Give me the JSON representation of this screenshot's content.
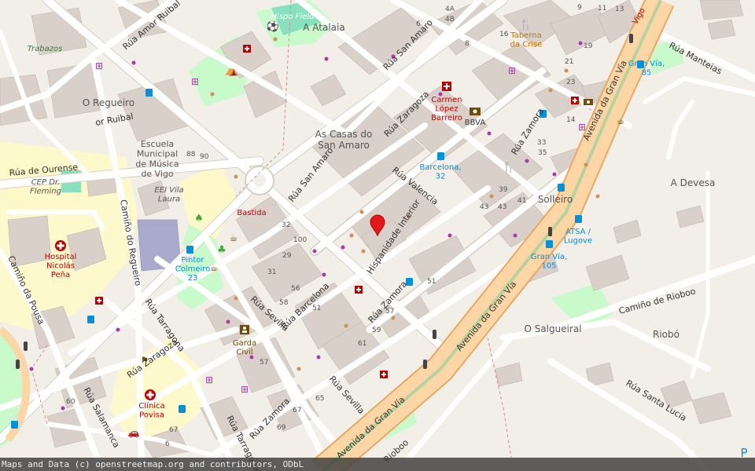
{
  "colors": {
    "background": "#f2efe9",
    "building": "#d9d0c9",
    "road_minor": "#ffffff",
    "road_primary": "#fcd6a4",
    "road_primary_casing": "#e9a863",
    "park": "#c8facc",
    "pitch": "#88e0be",
    "hospital_grounds": "#fdf9cc",
    "school_grounds": "#fff8c8",
    "healthcare_red": "#c00000",
    "shop_purple": "#ac39ac",
    "amenity_brown": "#734a08",
    "transport_blue": "#0092da",
    "marker_red": "#e31a1c"
  },
  "streets": [
    {
      "name": "Rúa de Ourense",
      "kind": "minor"
    },
    {
      "name": "Rúa Amor Ruibal",
      "kind": "minor"
    },
    {
      "name": "Rúa San Amaro",
      "kind": "minor"
    },
    {
      "name": "Rúa Zaragoza",
      "kind": "minor"
    },
    {
      "name": "Rúa Valencia",
      "kind": "minor"
    },
    {
      "name": "Rúa Zamora",
      "kind": "minor"
    },
    {
      "name": "Rúa Barcelona",
      "kind": "minor"
    },
    {
      "name": "Rúa Sevilla",
      "kind": "minor"
    },
    {
      "name": "Rúa Tarragona",
      "kind": "minor"
    },
    {
      "name": "Rúa Salamanca",
      "kind": "minor"
    },
    {
      "name": "Camiño do Regueiro",
      "kind": "minor"
    },
    {
      "name": "Camiño da Pousa",
      "kind": "minor"
    },
    {
      "name": "Avenida da Gran Vía",
      "kind": "primary"
    },
    {
      "name": "Rúa Manteias",
      "kind": "minor"
    },
    {
      "name": "Camiño de Rioboo",
      "kind": "minor"
    },
    {
      "name": "Rúa Santa Lucía",
      "kind": "minor"
    },
    {
      "name": "Hispanidade Interior",
      "kind": "minor"
    },
    {
      "name": "Rioboo",
      "kind": "minor"
    }
  ],
  "places": [
    {
      "name": "O Regueiro"
    },
    {
      "name": "As Casas do\nSan Amaro"
    },
    {
      "name": "A Atalaia"
    },
    {
      "name": "Solleiro"
    },
    {
      "name": "A Devesa"
    },
    {
      "name": "O Salgueiral"
    },
    {
      "name": "Riobó"
    },
    {
      "name": "Trabazos"
    },
    {
      "name": "Escuela\nMunicipal\nde Música\nde Vigo"
    },
    {
      "name": "EEI Vila\nLaura"
    },
    {
      "name": "CEP Dr.\nFleming"
    },
    {
      "name": "Bastida"
    },
    {
      "name": "Vigo"
    }
  ],
  "pois": [
    {
      "name": "Hospital\nNicolás\nPeña",
      "category": "hospital",
      "icon": "hospital-icon"
    },
    {
      "name": "Clínica\nPovisa",
      "category": "hospital",
      "icon": "hospital-icon"
    },
    {
      "name": "Carmen\nLópez\nBarreiro",
      "category": "pharmacy",
      "icon": "pharmacy-icon"
    },
    {
      "name": "Taberna\nda Crise",
      "category": "restaurant",
      "icon": "restaurant-icon"
    },
    {
      "name": "BBVA",
      "category": "bank",
      "icon": "bank-icon"
    },
    {
      "name": "Garda\nCivil",
      "category": "police",
      "icon": "police-icon"
    },
    {
      "name": "Hispo Field",
      "category": "sports",
      "icon": "pitch-icon"
    }
  ],
  "bus_stops": [
    {
      "name": "Barcelona,\n32"
    },
    {
      "name": "Gran Vía,\n85"
    },
    {
      "name": "ATSA /\nLugove"
    },
    {
      "name": "Gran Vía,\n105"
    },
    {
      "name": "Pintor\nColmeiro\n23"
    }
  ],
  "house_numbers": [
    "4A",
    "4B",
    "6",
    "8",
    "9",
    "11",
    "13",
    "16",
    "19",
    "21",
    "23",
    "33",
    "35",
    "39",
    "41",
    "43",
    "43",
    "88",
    "90",
    "100",
    "32",
    "29",
    "31",
    "56",
    "58",
    "51",
    "51",
    "57",
    "59",
    "61",
    "57",
    "65",
    "67",
    "69",
    "60",
    "67",
    "14",
    "6"
  ],
  "marker": {
    "name": "location-marker"
  },
  "attribution": "Maps and Data (c) openstreetmap.org and contributors, ODbL"
}
